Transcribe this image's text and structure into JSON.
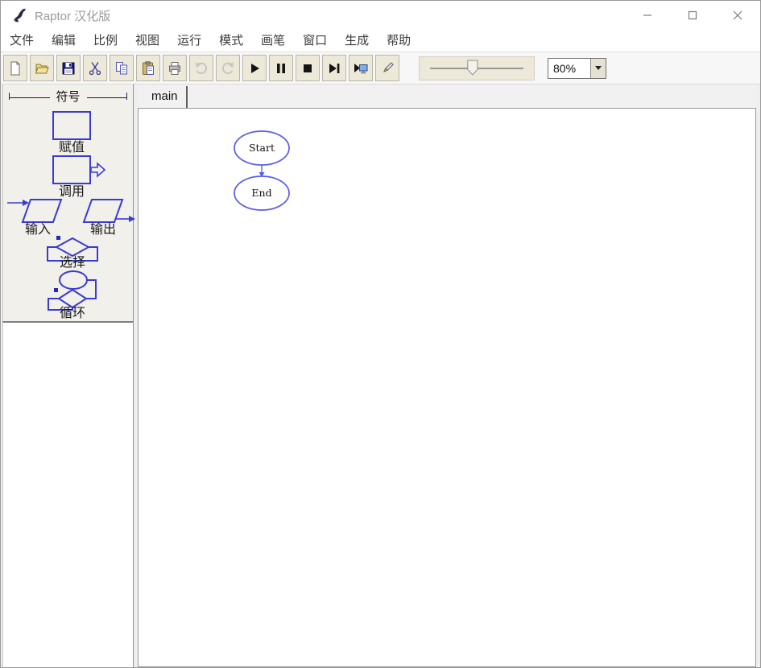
{
  "window": {
    "title": "Raptor 汉化版"
  },
  "menu": {
    "items": [
      "文件",
      "编辑",
      "比例",
      "视图",
      "运行",
      "模式",
      "画笔",
      "窗口",
      "生成",
      "帮助"
    ]
  },
  "toolbar": {
    "icons": [
      "new-file",
      "open-file",
      "save",
      "cut",
      "copy",
      "paste",
      "print",
      "undo",
      "redo",
      "play",
      "pause",
      "stop",
      "step-to-next",
      "run-to-end",
      "comment-pen"
    ],
    "zoom": {
      "value": "80%"
    },
    "speed_slider": {
      "position_percent": 45
    }
  },
  "sidebar": {
    "header": "符号",
    "symbols": [
      {
        "id": "assignment",
        "label": "赋值"
      },
      {
        "id": "call",
        "label": "调用"
      },
      {
        "id": "input",
        "label": "输入"
      },
      {
        "id": "output",
        "label": "输出"
      },
      {
        "id": "selection",
        "label": "选择"
      },
      {
        "id": "loop",
        "label": "循环"
      }
    ]
  },
  "tabs": [
    {
      "label": "main",
      "active": true
    }
  ],
  "canvas": {
    "nodes": [
      {
        "shape": "oval",
        "label": "Start"
      },
      {
        "shape": "oval",
        "label": "End"
      }
    ],
    "edges": [
      {
        "from": "Start",
        "to": "End"
      }
    ]
  },
  "colors": {
    "symbol_blue": "#3a3ad6",
    "flowchart_blue": "#5b5bf2",
    "toolbar_button_bg": "#ece9d8"
  }
}
